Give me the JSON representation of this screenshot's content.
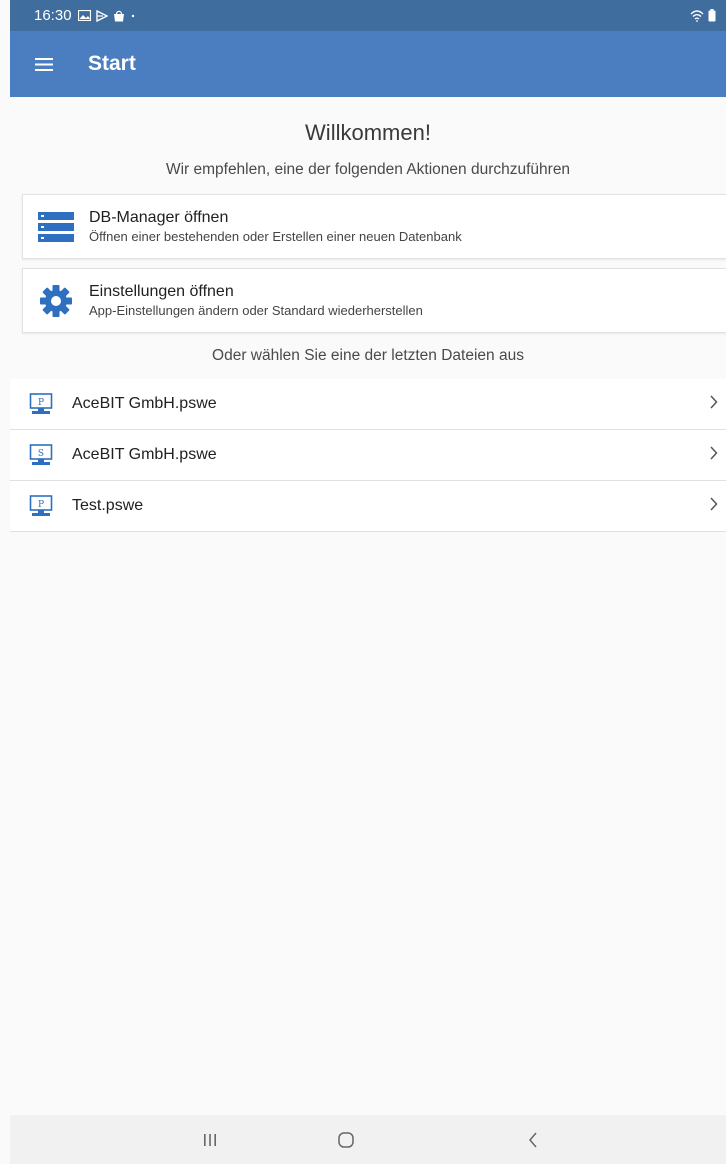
{
  "status_bar": {
    "time": "16:30",
    "icons": [
      "gallery-icon",
      "play-store-icon",
      "shopping-bag-icon",
      "dot-icon"
    ],
    "right_icons": [
      "wifi-icon",
      "battery-icon"
    ]
  },
  "app_bar": {
    "title": "Start",
    "menu_icon": "hamburger-menu-icon"
  },
  "main": {
    "welcome": "Willkommen!",
    "recommend": "Wir empfehlen, eine der folgenden Aktionen durchzuführen",
    "actions": [
      {
        "title": "DB-Manager öffnen",
        "subtitle": "Öffnen einer bestehenden oder Erstellen einer neuen Datenbank",
        "icon": "database-icon"
      },
      {
        "title": "Einstellungen öffnen",
        "subtitle": "App-Einstellungen ändern oder Standard wiederherstellen",
        "icon": "gear-icon"
      }
    ],
    "recent_label": "Oder wählen Sie eine der letzten Dateien aus",
    "recent_files": [
      {
        "name": "AceBIT GmbH.pswe",
        "badge": "P"
      },
      {
        "name": "AceBIT GmbH.pswe",
        "badge": "S"
      },
      {
        "name": "Test.pswe",
        "badge": "P"
      }
    ]
  },
  "colors": {
    "status_bar": "#3f6d9e",
    "app_bar": "#4a7ec0",
    "accent_icon": "#2f6fbf"
  },
  "nav_bar": {
    "buttons": [
      "recents-icon",
      "home-icon",
      "back-icon"
    ]
  }
}
